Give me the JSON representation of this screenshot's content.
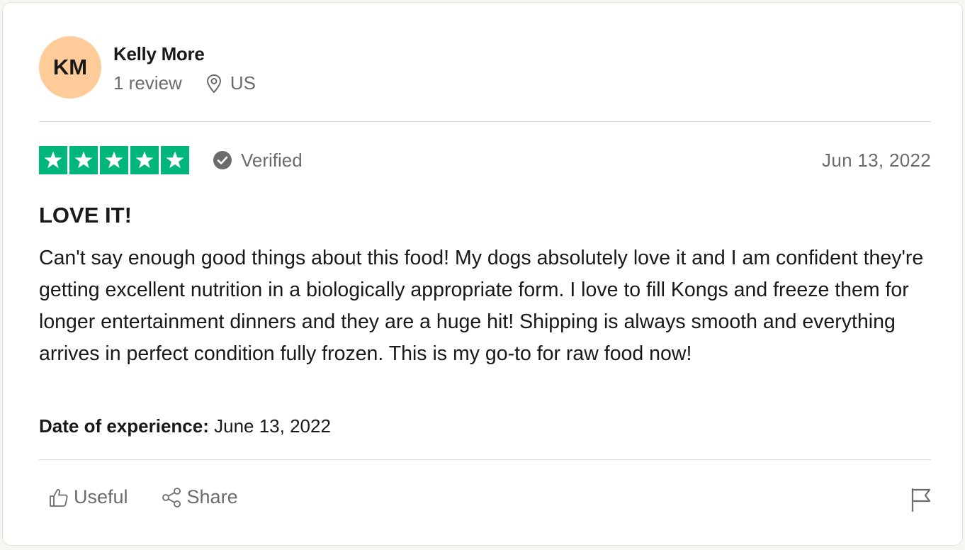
{
  "reviewer": {
    "initials": "KM",
    "avatar_color": "#ffcc99",
    "name": "Kelly More",
    "review_count": "1 review",
    "location": "US"
  },
  "rating": {
    "stars": 5,
    "star_color": "#00b67a",
    "verified_label": "Verified",
    "date": "Jun 13, 2022"
  },
  "review": {
    "title": "LOVE IT!",
    "text": "Can't say enough good things about this food! My dogs absolutely love it and I am confident they're getting excellent nutrition in a biologically appropriate form. I love to fill Kongs and freeze them for longer entertainment dinners and they are a huge hit! Shipping is always smooth and everything arrives in perfect condition fully frozen. This is my go-to for raw food now!",
    "experience_label": "Date of experience:",
    "experience_date": "June 13, 2022"
  },
  "actions": {
    "useful_label": "Useful",
    "share_label": "Share"
  },
  "icons": {
    "location": "map-pin-icon",
    "verified": "check-circle-icon",
    "useful": "thumbs-up-icon",
    "share": "share-icon",
    "report": "flag-icon"
  }
}
